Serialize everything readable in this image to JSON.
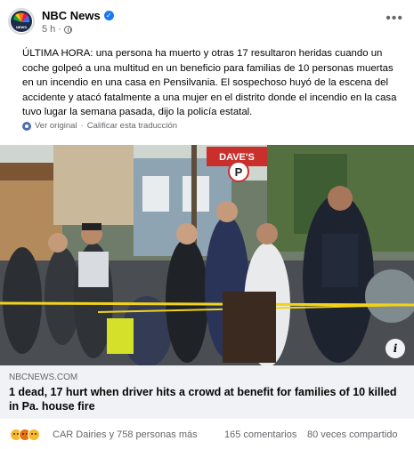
{
  "post": {
    "page_name": "NBC News",
    "time": "5 h",
    "text": "ÚLTIMA HORA: una persona ha muerto y otras 17 resultaron heridas cuando un coche golpeó a una multitud en un beneficio para familias de 10 personas muertas en un incendio en una casa en Pensilvania. El sospechoso huyó de la escena del accidente y atacó fatalmente a una mujer en el distrito donde el incendio en la casa tuvo lugar la semana pasada, dijo la policía estatal.",
    "see_original": "Ver original",
    "separator": "·",
    "rate_translation": "Calificar esta traducción"
  },
  "link": {
    "domain": "NBCNEWS.COM",
    "headline": "1 dead, 17 hurt when driver hits a crowd at benefit for families of 10 killed in Pa. house fire"
  },
  "photo": {
    "sign_text": "DAVE'S",
    "parking_letter": "P"
  },
  "reactions": {
    "icons": [
      "sad-icon",
      "angry-icon",
      "care-icon"
    ],
    "names": "CAR Dairies y 758 personas más",
    "comments": "165 comentarios",
    "shares": "80 veces compartido"
  },
  "colors": {
    "verified": "#1877f2",
    "secondary_text": "#65676b",
    "card_bg": "#f0f2f5"
  }
}
